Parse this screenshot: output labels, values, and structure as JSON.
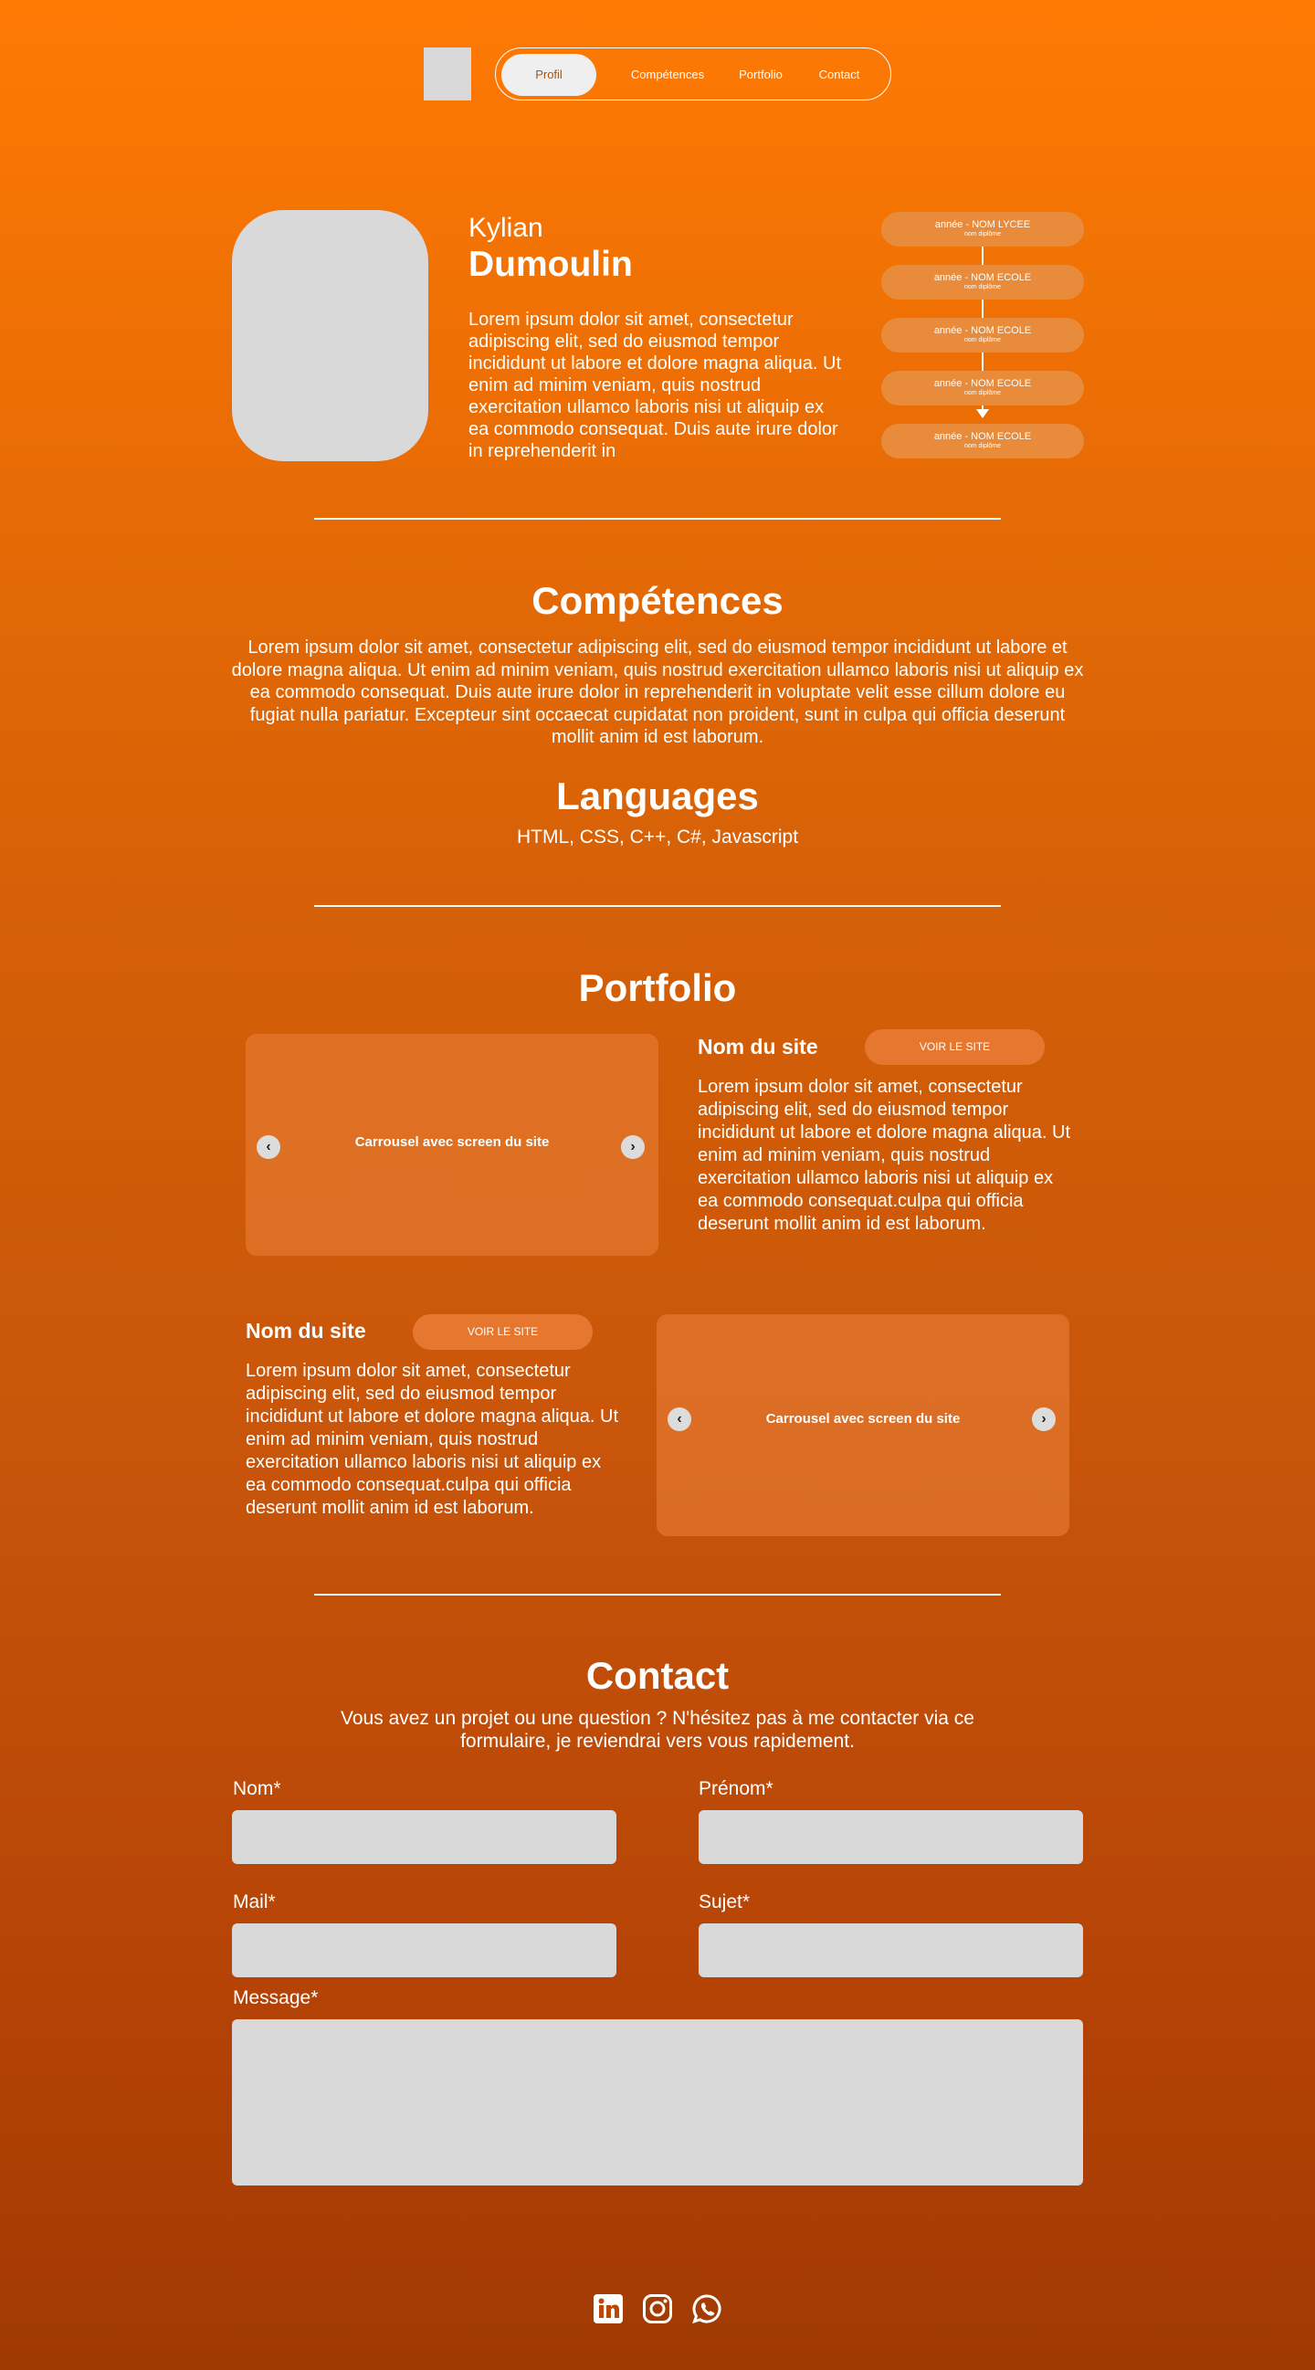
{
  "nav": {
    "items": [
      {
        "label": "Profil",
        "active": true
      },
      {
        "label": "Compétences"
      },
      {
        "label": "Portfolio"
      },
      {
        "label": "Contact"
      }
    ]
  },
  "profile": {
    "first_name": "Kylian",
    "last_name": "Dumoulin",
    "bio": "Lorem ipsum dolor sit amet, consectetur adipiscing elit, sed do eiusmod tempor incididunt ut labore et dolore magna aliqua. Ut enim ad minim veniam, quis nostrud exercitation ullamco laboris nisi ut aliquip ex ea commodo consequat. Duis aute irure dolor in reprehenderit in",
    "timeline": [
      {
        "title": "année - NOM LYCEE",
        "subtitle": "nom diplôme"
      },
      {
        "title": "année - NOM ECOLE",
        "subtitle": "nom diplôme"
      },
      {
        "title": "année - NOM ECOLE",
        "subtitle": "nom diplôme"
      },
      {
        "title": "année - NOM ECOLE",
        "subtitle": "nom diplôme"
      },
      {
        "title": "année - NOM ECOLE",
        "subtitle": "nom diplôme"
      }
    ]
  },
  "skills": {
    "title": "Compétences",
    "text": "Lorem ipsum dolor sit amet, consectetur adipiscing elit, sed do eiusmod tempor incididunt ut labore et dolore magna aliqua. Ut enim ad minim veniam, quis nostrud exercitation ullamco laboris nisi ut aliquip ex ea commodo consequat. Duis aute irure dolor in reprehenderit in voluptate velit esse cillum dolore eu fugiat nulla pariatur. Excepteur sint occaecat cupidatat non proident, sunt in culpa qui officia deserunt mollit anim id est laborum.",
    "languages_title": "Languages",
    "languages": "HTML, CSS, C++, C#, Javascript"
  },
  "portfolio": {
    "title": "Portfolio",
    "projects": [
      {
        "name": "Nom du site",
        "button": "VOIR LE SITE",
        "carousel_label": "Carrousel avec screen du site",
        "description": "Lorem ipsum dolor sit amet, consectetur adipiscing elit, sed do eiusmod tempor incididunt ut labore et dolore magna aliqua. Ut enim ad minim veniam, quis nostrud exercitation ullamco laboris nisi ut aliquip ex ea commodo consequat.culpa qui officia deserunt mollit anim id est laborum."
      },
      {
        "name": "Nom du site",
        "button": "VOIR LE SITE",
        "carousel_label": "Carrousel avec screen du site",
        "description": "Lorem ipsum dolor sit amet, consectetur adipiscing elit, sed do eiusmod tempor incididunt ut labore et dolore magna aliqua. Ut enim ad minim veniam, quis nostrud exercitation ullamco laboris nisi ut aliquip ex ea commodo consequat.culpa qui officia deserunt mollit anim id est laborum."
      }
    ],
    "prev_glyph": "‹",
    "next_glyph": "›"
  },
  "contact": {
    "title": "Contact",
    "intro": "Vous avez un projet ou une question ? N'hésitez pas à me contacter via ce formulaire, je reviendrai vers vous rapidement.",
    "fields": {
      "nom": "Nom*",
      "prenom": "Prénom*",
      "mail": "Mail*",
      "sujet": "Sujet*",
      "message": "Message*"
    }
  },
  "socials": [
    {
      "icon": "linkedin-icon"
    },
    {
      "icon": "instagram-icon"
    },
    {
      "icon": "whatsapp-icon"
    }
  ],
  "colors": {
    "gradient_top": "#ff7a05",
    "gradient_bottom": "#a03a02",
    "placeholder_gray": "#d9d9d9",
    "timeline_pill": "#e88b3a",
    "button_pill": "#e5772f"
  }
}
